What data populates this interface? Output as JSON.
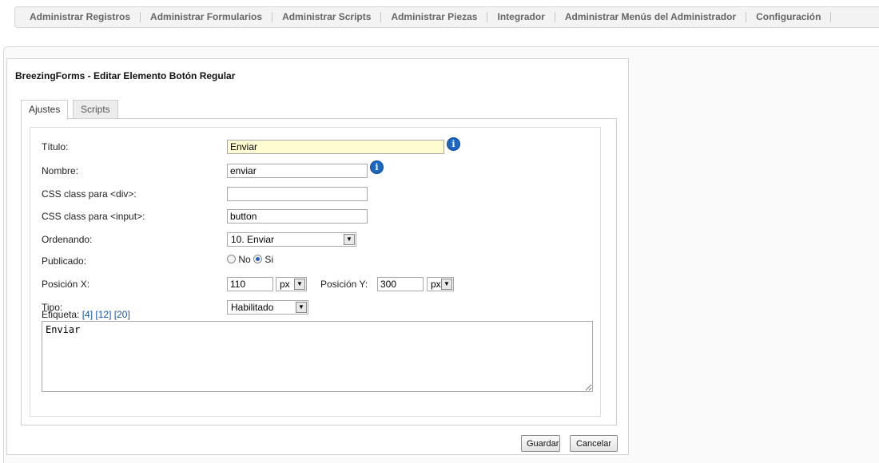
{
  "top_menu": [
    "Administrar Registros",
    "Administrar Formularios",
    "Administrar Scripts",
    "Administrar Piezas",
    "Integrador",
    "Administrar Menús del Administrador",
    "Configuración"
  ],
  "panel": {
    "title": "BreezingForms - Editar Elemento Botón Regular",
    "tabs": [
      "Ajustes",
      "Scripts"
    ]
  },
  "form": {
    "titulo_label": "Título:",
    "titulo_value": "Enviar",
    "nombre_label": "Nombre:",
    "nombre_value": "enviar",
    "css_div_label": "CSS class para <div>:",
    "css_div_value": "",
    "css_input_label": "CSS class para <input>:",
    "css_input_value": "button",
    "ordenando_label": "Ordenando:",
    "ordenando_value": "10. Enviar",
    "publicado_label": "Publicado:",
    "publicado_no": "No",
    "publicado_si": "Si",
    "pos_x_label": "Posición X:",
    "pos_x_value": "110",
    "pos_x_unit": "px",
    "pos_y_label": "Posición Y:",
    "pos_y_value": "300",
    "pos_y_unit": "px",
    "tipo_label": "Tipo:",
    "tipo_value": "Habilitado",
    "etiqueta_label": "Etiqueta:",
    "etiqueta_links": [
      "[4]",
      "[12]",
      "[20]"
    ],
    "etiqueta_value": "Enviar"
  },
  "buttons": {
    "save": "Guardar",
    "cancel": "Cancelar"
  },
  "colors": {
    "info_icon": "#1d67c4",
    "highlight_input": "#fffcd2",
    "link": "#1b57a5"
  }
}
